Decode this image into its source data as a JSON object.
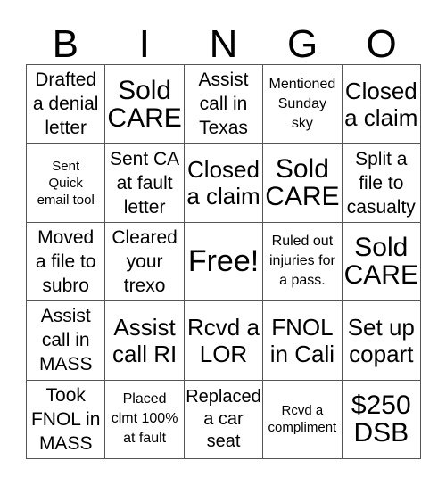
{
  "header": {
    "letters": [
      "B",
      "I",
      "N",
      "G",
      "O"
    ]
  },
  "card": {
    "cells": [
      {
        "text": "Drafted\na denial\nletter",
        "size": "md"
      },
      {
        "text": "Sold\nCARE",
        "size": "xl"
      },
      {
        "text": "Assist\ncall in\nTexas",
        "size": "md"
      },
      {
        "text": "Mentioned\nSunday\nsky",
        "size": "xs"
      },
      {
        "text": "Closed\na claim",
        "size": "lg"
      },
      {
        "text": "Sent\nQuick\nemail tool",
        "size": "xxs"
      },
      {
        "text": "Sent CA\nat fault\nletter",
        "size": "md"
      },
      {
        "text": "Closed\na claim",
        "size": "lg"
      },
      {
        "text": "Sold\nCARE",
        "size": "xl"
      },
      {
        "text": "Split a\nfile to\ncasualty",
        "size": "md"
      },
      {
        "text": "Moved\na file to\nsubro",
        "size": "md"
      },
      {
        "text": "Cleared\nyour\ntrexo",
        "size": "md"
      },
      {
        "text": "Free!",
        "size": "free"
      },
      {
        "text": "Ruled out\ninjuries for\na pass.",
        "size": "xs"
      },
      {
        "text": "Sold\nCARE",
        "size": "xl"
      },
      {
        "text": "Assist\ncall in\nMASS",
        "size": "md"
      },
      {
        "text": "Assist\ncall RI",
        "size": "lg"
      },
      {
        "text": "Rcvd a\nLOR",
        "size": "lg"
      },
      {
        "text": "FNOL\nin Cali",
        "size": "lg"
      },
      {
        "text": "Set up\ncopart",
        "size": "lg"
      },
      {
        "text": "Took\nFNOL in\nMASS",
        "size": "md"
      },
      {
        "text": "Placed\nclmt 100%\nat fault",
        "size": "xs"
      },
      {
        "text": "Replaced\na car\nseat",
        "size": "sm"
      },
      {
        "text": "Rcvd a\ncompliment",
        "size": "xxs"
      },
      {
        "text": "$250\nDSB",
        "size": "xl"
      }
    ]
  }
}
